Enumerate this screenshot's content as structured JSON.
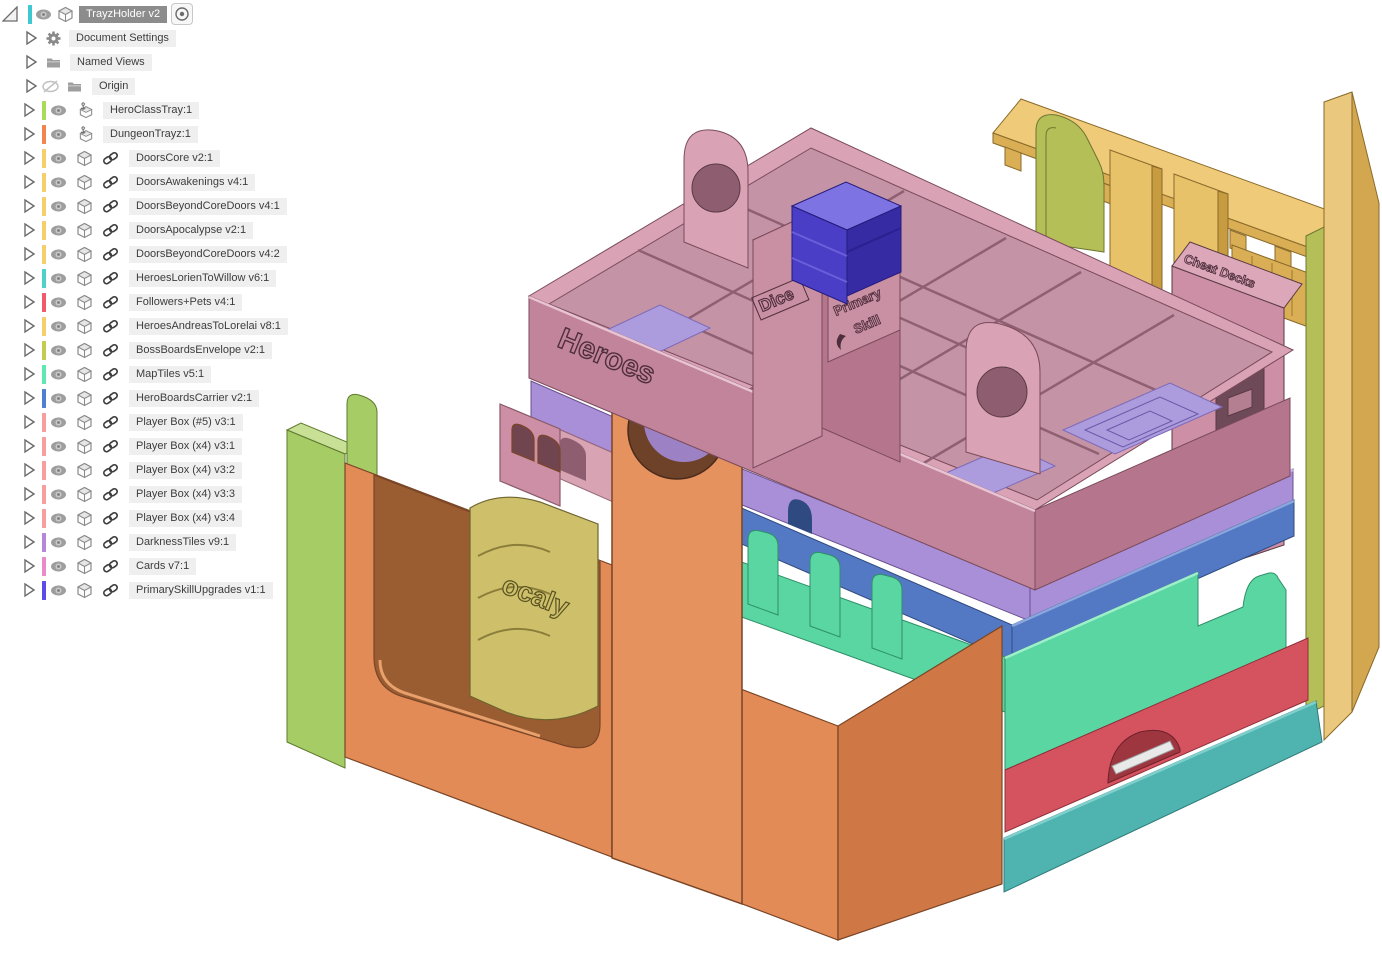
{
  "browser": {
    "root": {
      "label": "TrayzHolder v2",
      "color": "#3EC8D2"
    },
    "items": [
      {
        "label": "Document Settings",
        "type": "settings",
        "color": ""
      },
      {
        "label": "Named Views",
        "type": "folder",
        "color": ""
      },
      {
        "label": "Origin",
        "type": "origin",
        "color": ""
      },
      {
        "label": "HeroClassTray:1",
        "type": "ground",
        "color": "#A8DB5A"
      },
      {
        "label": "DungeonTrayz:1",
        "type": "ground",
        "color": "#F2854D"
      },
      {
        "label": "DoorsCore v2:1",
        "type": "linked",
        "color": "#F7CE6E"
      },
      {
        "label": "DoorsAwakenings v4:1",
        "type": "linked",
        "color": "#F7CE6E"
      },
      {
        "label": "DoorsBeyondCoreDoors v4:1",
        "type": "linked",
        "color": "#F7CE6E"
      },
      {
        "label": "DoorsApocalypse v2:1",
        "type": "linked",
        "color": "#F7CE6E"
      },
      {
        "label": "DoorsBeyondCoreDoors v4:2",
        "type": "linked",
        "color": "#F7CE6E"
      },
      {
        "label": "HeroesLorienToWillow v6:1",
        "type": "linked",
        "color": "#4FD0C9"
      },
      {
        "label": "Followers+Pets v4:1",
        "type": "linked",
        "color": "#F25A6B"
      },
      {
        "label": "HeroesAndreasToLorelai v8:1",
        "type": "linked",
        "color": "#F7CE6E"
      },
      {
        "label": "BossBoardsEnvelope v2:1",
        "type": "linked",
        "color": "#C2CC4E"
      },
      {
        "label": "MapTiles v5:1",
        "type": "linked",
        "color": "#5FE8B0"
      },
      {
        "label": "HeroBoardsCarrier v2:1",
        "type": "linked",
        "color": "#4E7FD2"
      },
      {
        "label": "Player Box (#5) v3:1",
        "type": "linked",
        "color": "#F79E9E"
      },
      {
        "label": "Player Box (x4) v3:1",
        "type": "linked",
        "color": "#F79E9E"
      },
      {
        "label": "Player Box (x4) v3:2",
        "type": "linked",
        "color": "#F79E9E"
      },
      {
        "label": "Player Box (x4) v3:3",
        "type": "linked",
        "color": "#F79E9E"
      },
      {
        "label": "Player Box (x4) v3:4",
        "type": "linked",
        "color": "#F79E9E"
      },
      {
        "label": "DarknessTiles v9:1",
        "type": "linked",
        "color": "#B586DB"
      },
      {
        "label": "Cards v7:1",
        "type": "linked",
        "color": "#E98BC8"
      },
      {
        "label": "PrimarySkillUpgrades v1:1",
        "type": "linked",
        "color": "#5B4BE8"
      }
    ]
  },
  "viewport": {
    "model_labels": {
      "heroes": "Heroes",
      "dice": "Dice",
      "primary_line1": "Primary",
      "primary_line2": "Skill",
      "cheat_decks": "Cheat Decks",
      "apocalypse_fragment": "ocaly"
    },
    "colors": {
      "orange": "#E28B57",
      "orange_side": "#CF7845",
      "green": "#A6CC66",
      "pink_rim": "#D9A3B5",
      "pink_wall": "#C2849B",
      "purple": "#A98FD8",
      "blue": "#5479C4",
      "mint": "#59D6A2",
      "red": "#D5525F",
      "teal": "#4FB4B0",
      "yellow": "#EFCB79",
      "tan_wall": "#EAC87D",
      "olive": "#B5BF58",
      "indigo_box": "#4A3EC6",
      "apocalypse_yellow": "#CEC06A"
    }
  }
}
